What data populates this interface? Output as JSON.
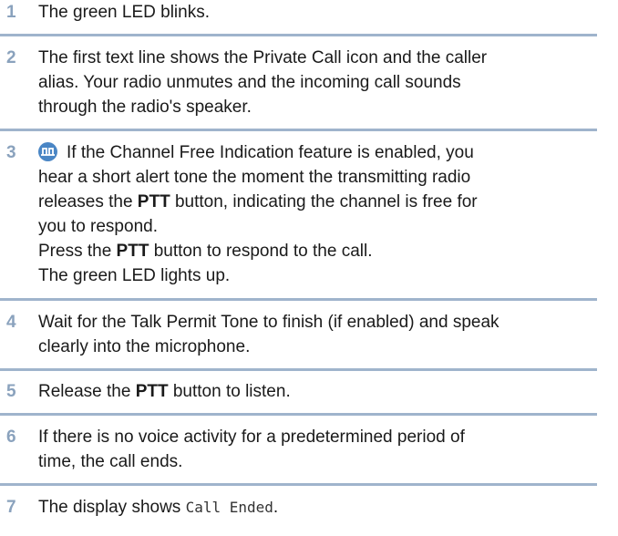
{
  "steps": [
    {
      "num": "1",
      "lines": [
        [
          "The green LED blinks."
        ]
      ]
    },
    {
      "num": "2",
      "lines": [
        [
          "The first text line shows the Private Call icon and the caller"
        ],
        [
          "alias. Your radio unmutes and the incoming call sounds"
        ],
        [
          "through the radio's speaker."
        ]
      ]
    },
    {
      "num": "3",
      "icon": "channel-free-indication-icon",
      "lines": [
        [
          "If the Channel Free Indication feature is enabled, you"
        ],
        [
          "hear a short alert tone the moment the transmitting radio"
        ],
        [
          "releases the ",
          "PTT",
          " button, indicating the channel is free for"
        ],
        [
          "you to respond."
        ],
        [
          "Press the ",
          "PTT",
          " button to respond to the call."
        ],
        [
          "The green LED lights up."
        ]
      ]
    },
    {
      "num": "4",
      "lines": [
        [
          "Wait for the Talk Permit Tone to finish (if enabled) and speak"
        ],
        [
          "clearly into the microphone."
        ]
      ]
    },
    {
      "num": "5",
      "lines": [
        [
          "Release the ",
          "PTT",
          " button to listen."
        ]
      ]
    },
    {
      "num": "6",
      "lines": [
        [
          "If there is no voice activity for a predetermined period of"
        ],
        [
          "time, the call ends."
        ]
      ]
    },
    {
      "num": "7",
      "lines": [
        [
          "The display shows ",
          "Call Ended",
          "."
        ]
      ]
    }
  ]
}
